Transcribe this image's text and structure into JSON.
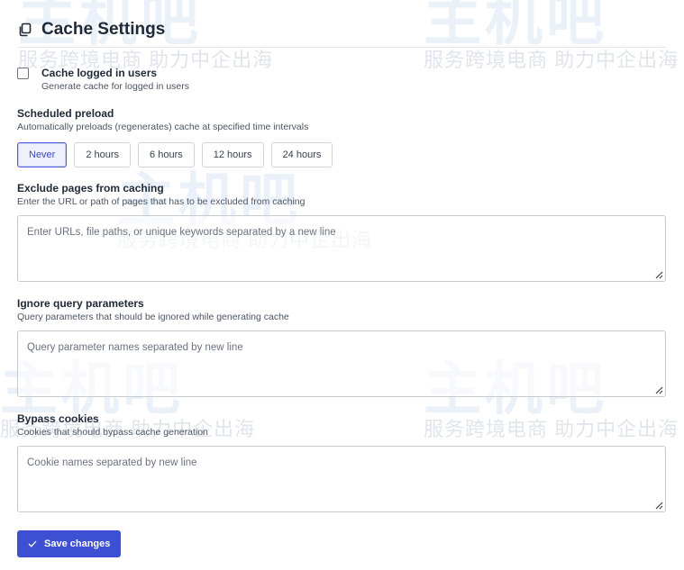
{
  "header": {
    "title": "Cache Settings",
    "icon": "copy-icon"
  },
  "logged_in": {
    "label": "Cache logged in users",
    "description": "Generate cache for logged in users",
    "checked": false
  },
  "preload": {
    "label": "Scheduled preload",
    "description": "Automatically preloads (regenerates) cache at specified time intervals",
    "options": [
      "Never",
      "2 hours",
      "6 hours",
      "12 hours",
      "24 hours"
    ],
    "selected": "Never"
  },
  "exclude": {
    "label": "Exclude pages from caching",
    "description": "Enter the URL or path of pages that has to be excluded from caching",
    "placeholder": "Enter URLs, file paths, or unique keywords separated by a new line"
  },
  "ignore_query": {
    "label": "Ignore query parameters",
    "description": "Query parameters that should be ignored while generating cache",
    "placeholder": "Query parameter names separated by new line"
  },
  "bypass": {
    "label": "Bypass cookies",
    "description": "Cookies that should bypass cache generation",
    "placeholder": "Cookie names separated by new line"
  },
  "save": {
    "label": "Save changes",
    "icon": "check-icon"
  },
  "watermark": {
    "brand": "主机吧",
    "slogan": "服务跨境电商 助力中企出海"
  },
  "colors": {
    "accent": "#3d4fd3",
    "active_bg": "#eef0fb"
  }
}
